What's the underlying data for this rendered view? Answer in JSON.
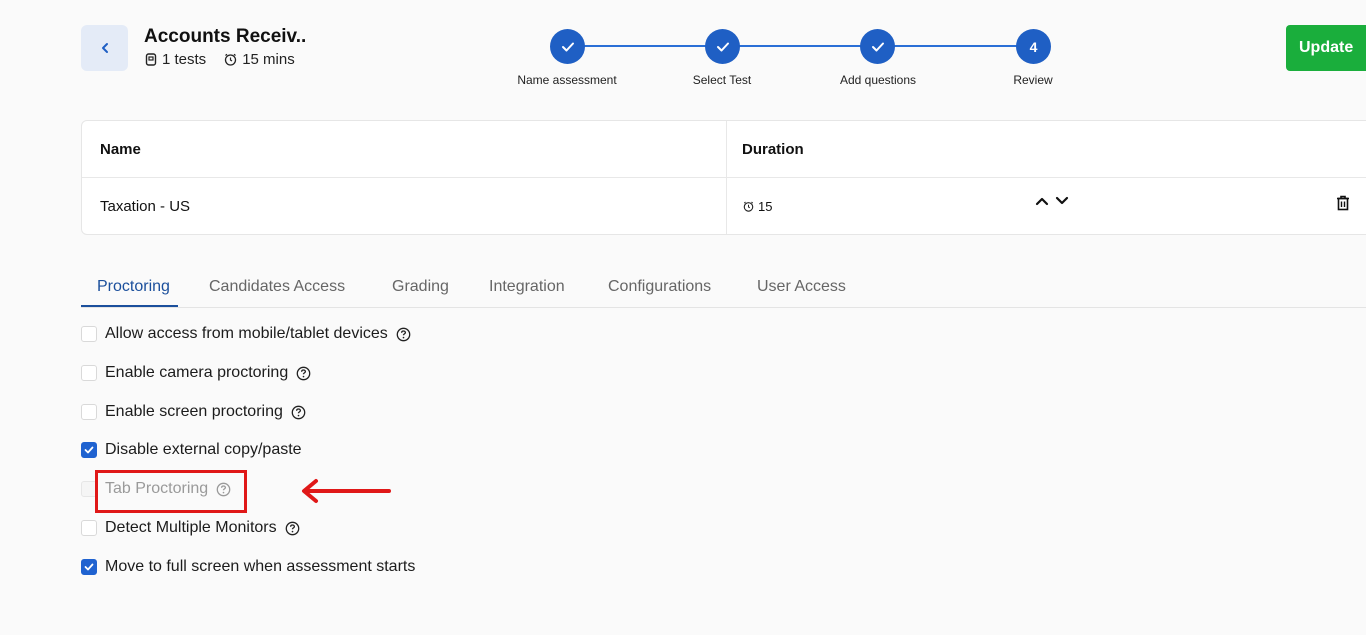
{
  "header": {
    "back_icon": "chevron-left-icon",
    "title": "Accounts Receiv..",
    "tests_count": "1 tests",
    "duration": "15 mins",
    "update_label": "Update"
  },
  "stepper": {
    "steps": [
      {
        "label": "Name assessment",
        "state": "done",
        "number": ""
      },
      {
        "label": "Select Test",
        "state": "done",
        "number": ""
      },
      {
        "label": "Add questions",
        "state": "done",
        "number": ""
      },
      {
        "label": "Review",
        "state": "current",
        "number": "4"
      }
    ],
    "accent": "#1f5fc4"
  },
  "table": {
    "headers": {
      "name": "Name",
      "duration": "Duration"
    },
    "rows": [
      {
        "name": "Taxation - US",
        "duration": "15"
      }
    ]
  },
  "tabs": [
    {
      "label": "Proctoring",
      "active": true
    },
    {
      "label": "Candidates Access"
    },
    {
      "label": "Grading"
    },
    {
      "label": "Integration"
    },
    {
      "label": "Configurations"
    },
    {
      "label": "User Access"
    }
  ],
  "proctoring": {
    "options": [
      {
        "label": "Allow access from mobile/tablet devices",
        "checked": false,
        "help": true
      },
      {
        "label": "Enable camera proctoring",
        "checked": false,
        "help": true
      },
      {
        "label": "Enable screen proctoring",
        "checked": false,
        "help": true
      },
      {
        "label": "Disable external copy/paste",
        "checked": true,
        "help": false
      },
      {
        "label": "Tab Proctoring",
        "checked": false,
        "help": true,
        "disabled": true
      },
      {
        "label": "Detect Multiple Monitors",
        "checked": false,
        "help": true
      },
      {
        "label": "Move to full screen when assessment starts",
        "checked": true,
        "help": false
      }
    ]
  },
  "colors": {
    "update_green": "#1aae3c",
    "annotation_red": "#e01818",
    "tab_active": "#1b4f9c"
  }
}
